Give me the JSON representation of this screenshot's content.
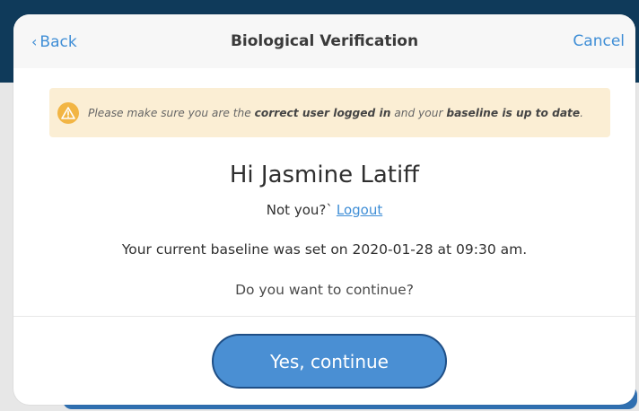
{
  "header": {
    "back_label": "Back",
    "title": "Biological Verification",
    "cancel_label": "Cancel"
  },
  "warning": {
    "icon": "warning-triangle-icon",
    "prefix": "Please make sure you are the ",
    "bold1": "correct user logged in",
    "middle": " and your ",
    "bold2": "baseline is up to date",
    "suffix": "."
  },
  "greeting": "Hi Jasmine Latiff",
  "not_you": {
    "prompt": "Not you?`",
    "logout_label": "Logout"
  },
  "baseline_text": "Your current baseline was set on 2020-01-28 at 09:30 am.",
  "question": "Do you want to continue?",
  "actions": {
    "continue_label": "Yes, continue"
  },
  "colors": {
    "accent": "#3f8ed6",
    "primary_button": "#4a8fd3",
    "warning_bg": "#fbeed4",
    "warning_icon": "#f2b544",
    "header_bar": "#0f3a5a"
  }
}
